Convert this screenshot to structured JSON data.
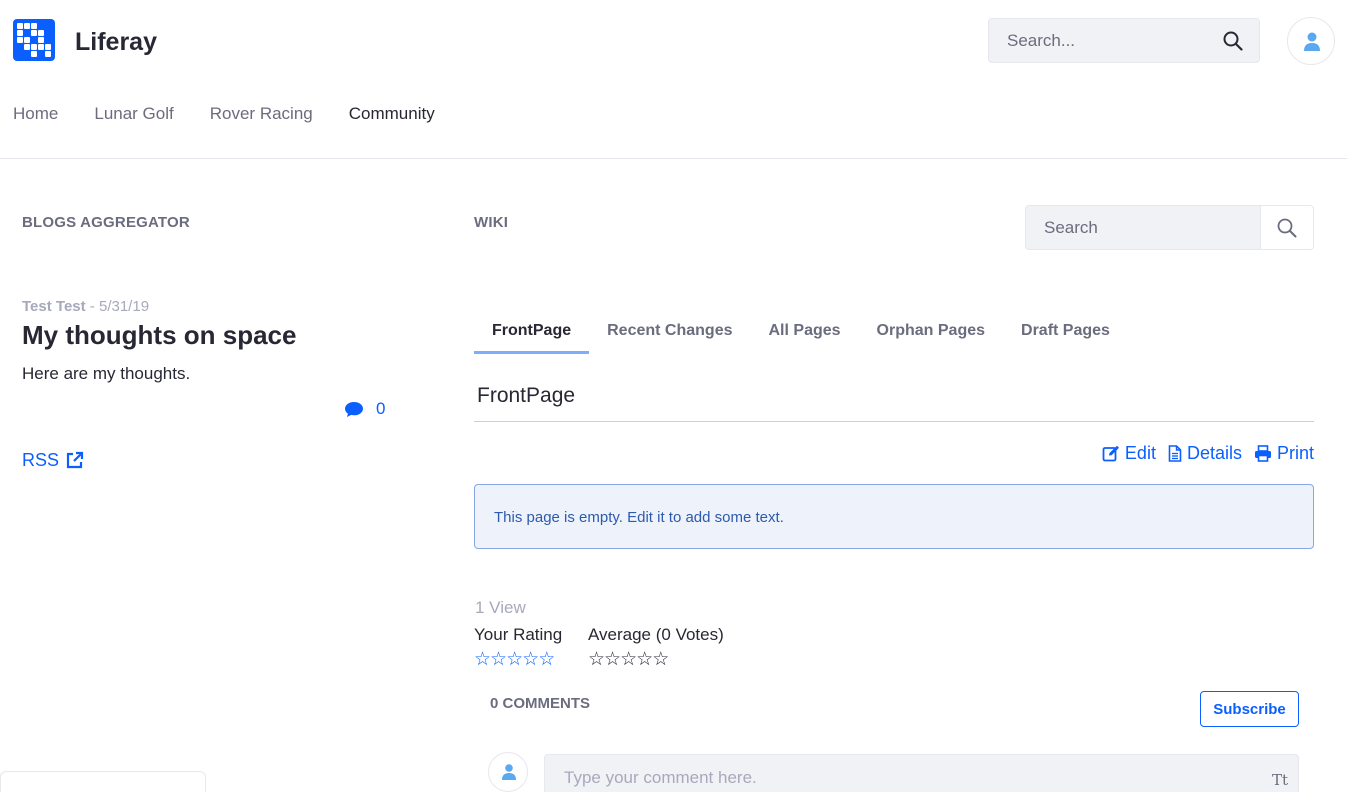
{
  "site": {
    "name": "Liferay"
  },
  "header": {
    "search_placeholder": "Search..."
  },
  "nav": {
    "items": [
      "Home",
      "Lunar Golf",
      "Rover Racing",
      "Community"
    ],
    "active": "Community"
  },
  "blogs": {
    "section_title": "BLOGS AGGREGATOR",
    "entry": {
      "author": "Test Test",
      "separator": " - ",
      "date": "5/31/19",
      "title": "My thoughts on space",
      "summary": "Here are my thoughts.",
      "comment_count": "0"
    },
    "rss_label": "RSS"
  },
  "wiki": {
    "section_title": "WIKI",
    "search_placeholder": "Search",
    "tabs": [
      "FrontPage",
      "Recent Changes",
      "All Pages",
      "Orphan Pages",
      "Draft Pages"
    ],
    "active_tab": "FrontPage",
    "page_title": "FrontPage",
    "actions": {
      "edit": "Edit",
      "details": "Details",
      "print": "Print"
    },
    "empty_message": "This page is empty. Edit it to add some text.",
    "views": "1 View",
    "your_rating_label": "Your Rating",
    "average_label": "Average (0 Votes)",
    "your_rating_value": 0,
    "average_value": 0,
    "comments_header": "0 COMMENTS",
    "subscribe_label": "Subscribe",
    "comment_placeholder": "Type your comment here.",
    "text_format_label": "Tt"
  },
  "colors": {
    "accent": "#0b5fff",
    "info_bg": "#eef2fa",
    "info_text": "#2e5aac"
  }
}
